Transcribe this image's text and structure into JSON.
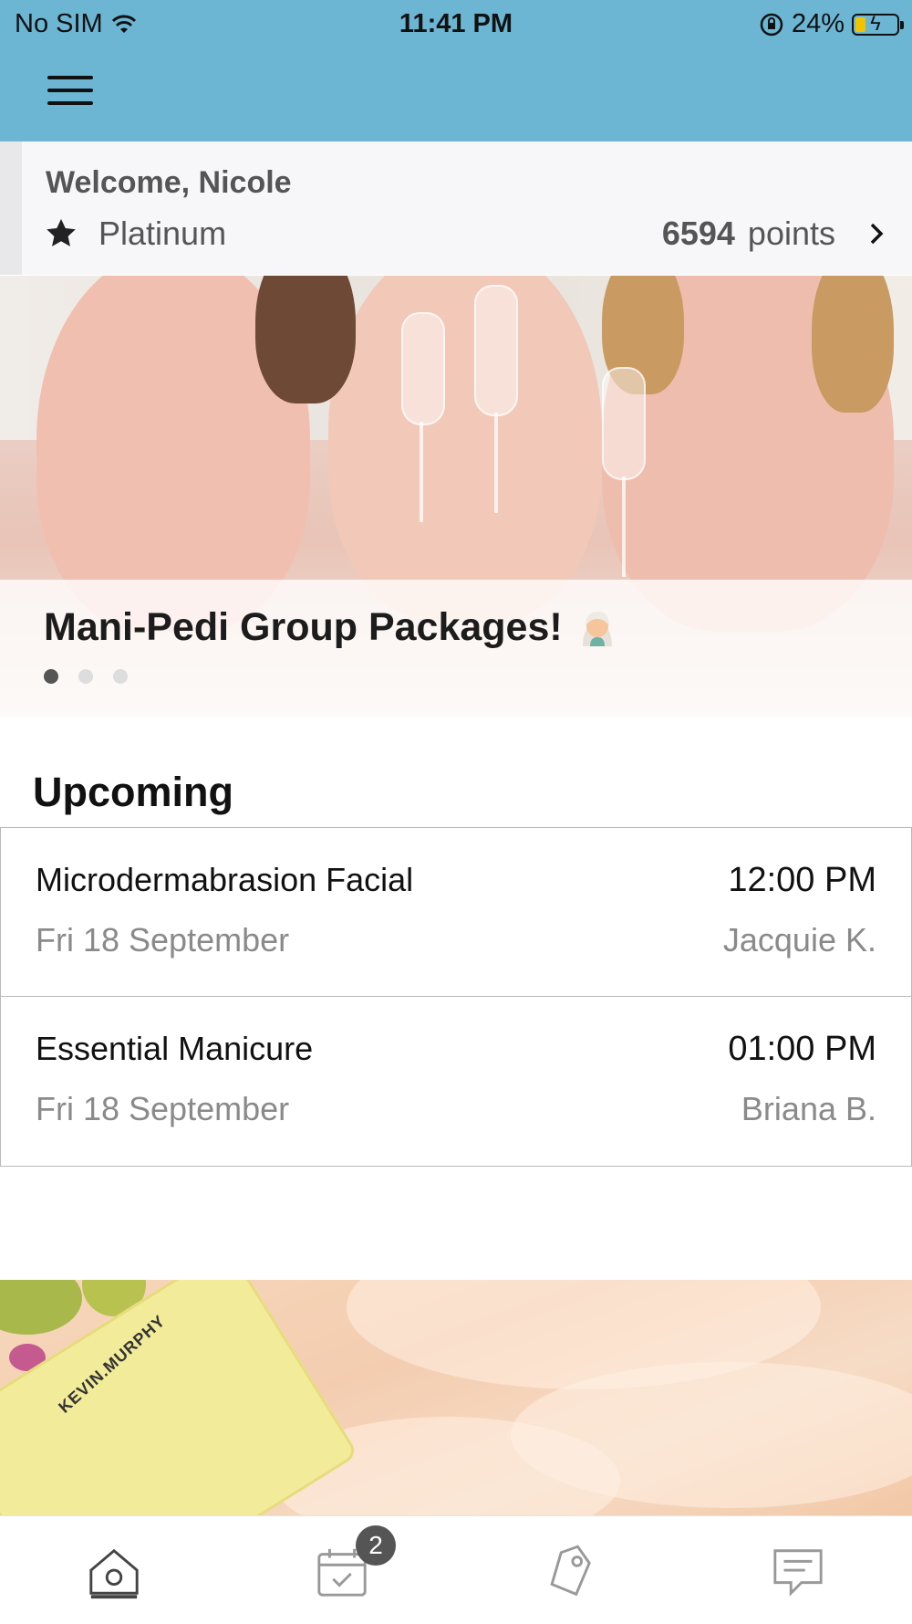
{
  "status_bar": {
    "carrier": "No SIM",
    "time": "11:41 PM",
    "battery": "24%",
    "battery_level": 0.24
  },
  "header": {
    "menu_icon": "hamburger-menu-icon"
  },
  "welcome": {
    "title": "Welcome, Nicole",
    "tier": "Platinum",
    "tier_icon": "star-icon",
    "points_value": "6594",
    "points_label": "points"
  },
  "banner": {
    "title": "Mani-Pedi Group Packages!",
    "emoji_icon": "woman-with-headscarf-emoji",
    "slide_count": 3,
    "active_slide": 1
  },
  "upcoming": {
    "title": "Upcoming",
    "appointments": [
      {
        "service": "Microdermabrasion Facial",
        "date": "Fri 18 September",
        "time": "12:00 PM",
        "staff": "Jacquie K."
      },
      {
        "service": "Essential Manicure",
        "date": "Fri 18 September",
        "time": "01:00 PM",
        "staff": "Briana B."
      }
    ]
  },
  "promo": {
    "brand_text": "KEVIN.MURPHY"
  },
  "tabbar": {
    "tabs": [
      {
        "name": "home-icon",
        "active": true
      },
      {
        "name": "calendar-icon",
        "badge": "2"
      },
      {
        "name": "tag-icon"
      },
      {
        "name": "chat-icon"
      }
    ]
  }
}
